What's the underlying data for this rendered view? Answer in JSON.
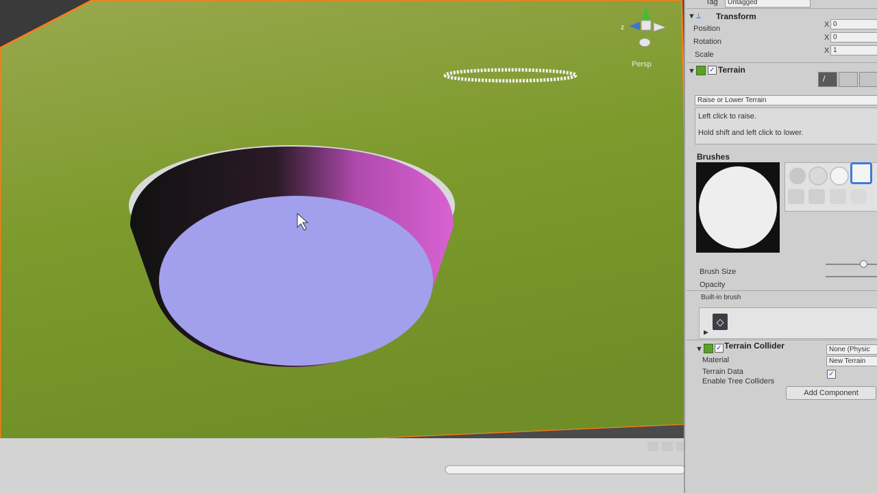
{
  "scene": {
    "persp_label": "Persp",
    "gizmo_axis_z": "z",
    "colors": {
      "terrain": "#7c9a2c",
      "hole_floor": "#a2a0ec",
      "hole_wall_pink": "#d25ad0",
      "selection_outline": "#ff7a1a"
    }
  },
  "inspector": {
    "tag_label": "Tag",
    "tag_value": "Untagged",
    "transform": {
      "title": "Transform",
      "position_label": "Position",
      "rotation_label": "Rotation",
      "scale_label": "Scale",
      "axis_x": "X",
      "position_x": "0",
      "rotation_x": "0",
      "scale_x": "1"
    },
    "terrain": {
      "title": "Terrain",
      "tool_dropdown": "Raise or Lower Terrain",
      "help_line1": "Left click to raise.",
      "help_line2": "Hold shift and left click to lower.",
      "brushes_label": "Brushes",
      "brush_size_label": "Brush Size",
      "opacity_label": "Opacity",
      "builtin_brush_label": "Built-in brush"
    },
    "collider": {
      "title": "Terrain Collider",
      "material_label": "Material",
      "material_value": "None (Physic",
      "terrain_data_label": "Terrain Data",
      "terrain_data_value": "New Terrain",
      "enable_tree_label": "Enable Tree Colliders"
    },
    "add_component": "Add Component"
  }
}
